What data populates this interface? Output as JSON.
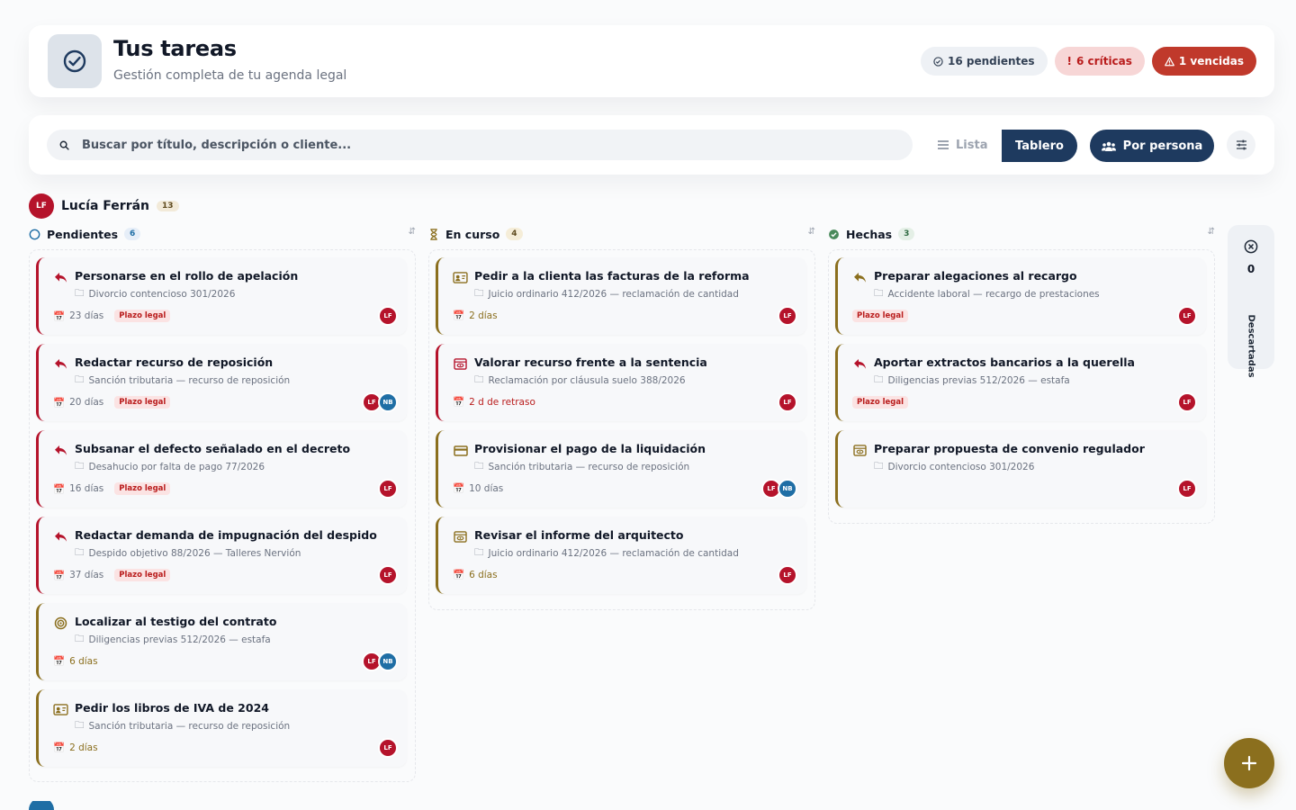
{
  "header": {
    "title": "Tus tareas",
    "subtitle": "Gestión completa de tu agenda legal",
    "badges": {
      "pending": "16 pendientes",
      "critical": "6 críticas",
      "overdue": "1 vencidas"
    }
  },
  "toolbar": {
    "search_placeholder": "Buscar por título, descripción o cliente...",
    "view_list": "Lista",
    "view_board": "Tablero",
    "view_person": "Por persona"
  },
  "person": {
    "initials": "LF",
    "name": "Lucía Ferrán",
    "count": "13"
  },
  "columns": [
    {
      "title": "Pendientes",
      "count": "6",
      "cards": [
        {
          "title": "Personarse en el rollo de apelación",
          "case": "Divorcio contencioso 301/2026",
          "meta": "23 días",
          "chip": "Plazo legal",
          "icon": "reply-arrow-icon",
          "avatars": [
            "LF"
          ]
        },
        {
          "title": "Redactar recurso de reposición",
          "case": "Sanción tributaria — recurso de reposición",
          "meta": "20 días",
          "chip": "Plazo legal",
          "icon": "reply-arrow-icon",
          "avatars": [
            "LF",
            "NB"
          ]
        },
        {
          "title": "Subsanar el defecto señalado en el decreto",
          "case": "Desahucio por falta de pago 77/2026",
          "meta": "16 días",
          "chip": "Plazo legal",
          "icon": "reply-arrow-icon",
          "avatars": [
            "LF"
          ]
        },
        {
          "title": "Redactar demanda de impugnación del despido",
          "case": "Despido objetivo 88/2026 — Talleres Nervión",
          "meta": "37 días",
          "chip": "Plazo legal",
          "icon": "reply-arrow-icon",
          "avatars": [
            "LF"
          ]
        },
        {
          "title": "Localizar al testigo del contrato",
          "case": "Diligencias previas 512/2026 — estafa",
          "meta": "6 días",
          "chip": "",
          "icon": "target-icon",
          "avatars": [
            "LF",
            "NB"
          ]
        },
        {
          "title": "Pedir los libros de IVA de 2024",
          "case": "Sanción tributaria — recurso de reposición",
          "meta": "2 días",
          "chip": "",
          "icon": "contact-card-icon",
          "avatars": [
            "LF"
          ]
        }
      ]
    },
    {
      "title": "En curso",
      "count": "4",
      "cards": [
        {
          "title": "Pedir a la clienta las facturas de la reforma",
          "case": "Juicio ordinario 412/2026 — reclamación de cantidad",
          "meta": "2 días",
          "chip": "",
          "icon": "contact-card-icon",
          "avatars": [
            "LF"
          ]
        },
        {
          "title": "Valorar recurso frente a la sentencia",
          "case": "Reclamación por cláusula suelo 388/2026",
          "meta": "2 d de retraso",
          "chip": "",
          "icon": "review-icon",
          "avatars": [
            "LF"
          ]
        },
        {
          "title": "Provisionar el pago de la liquidación",
          "case": "Sanción tributaria — recurso de reposición",
          "meta": "10 días",
          "chip": "",
          "icon": "payment-card-icon",
          "avatars": [
            "LF",
            "NB"
          ]
        },
        {
          "title": "Revisar el informe del arquitecto",
          "case": "Juicio ordinario 412/2026 — reclamación de cantidad",
          "meta": "6 días",
          "chip": "",
          "icon": "review-icon",
          "avatars": [
            "LF"
          ]
        }
      ]
    },
    {
      "title": "Hechas",
      "count": "3",
      "cards": [
        {
          "title": "Preparar alegaciones al recargo",
          "case": "Accidente laboral — recargo de prestaciones",
          "meta": "",
          "chip": "Plazo legal",
          "icon": "reply-arrow-icon",
          "avatars": [
            "LF"
          ]
        },
        {
          "title": "Aportar extractos bancarios a la querella",
          "case": "Diligencias previas 512/2026 — estafa",
          "meta": "",
          "chip": "Plazo legal",
          "icon": "reply-arrow-icon",
          "avatars": [
            "LF"
          ]
        },
        {
          "title": "Preparar propuesta de convenio regulador",
          "case": "Divorcio contencioso 301/2026",
          "meta": "",
          "chip": "",
          "icon": "review-icon",
          "avatars": [
            "LF"
          ]
        }
      ]
    }
  ],
  "discarded": {
    "count": "0",
    "label": "Descartadas"
  },
  "colors": {
    "primary_navy": "#1e3a5f",
    "crimson": "#b5132b",
    "gold": "#8b6f1e",
    "danger": "#c0392b",
    "blue_avatar": "#1f6ea5"
  }
}
